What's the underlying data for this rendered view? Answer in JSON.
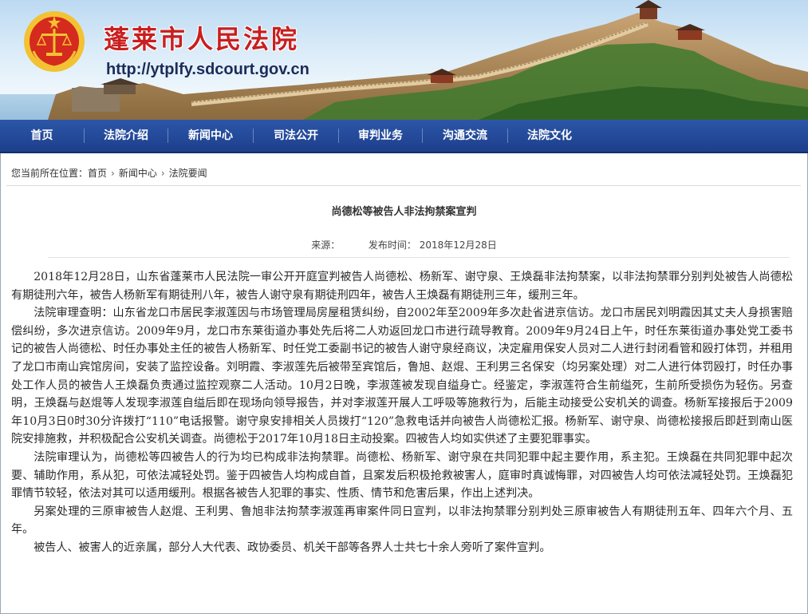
{
  "site": {
    "title": "蓬莱市人民法院",
    "url": "http://ytplfy.sdcourt.gov.cn"
  },
  "nav": {
    "items": [
      "首页",
      "法院介绍",
      "新闻中心",
      "司法公开",
      "审判业务",
      "沟通交流",
      "法院文化"
    ]
  },
  "breadcrumb": {
    "prefix": "您当前所在位置：",
    "items": [
      "首页",
      "新闻中心",
      "法院要闻"
    ],
    "separator": "›"
  },
  "article": {
    "title": "尚德松等被告人非法拘禁案宣判",
    "source_label": "来源：",
    "date_label": "发布时间：",
    "date": "2018年12月28日",
    "paragraphs": [
      "2018年12月28日，山东省蓬莱市人民法院一审公开开庭宣判被告人尚德松、杨新军、谢守泉、王焕磊非法拘禁案，以非法拘禁罪分别判处被告人尚德松有期徒刑六年，被告人杨新军有期徒刑八年，被告人谢守泉有期徒刑四年，被告人王焕磊有期徒刑三年，缓刑三年。",
      "法院审理查明：山东省龙口市居民李淑莲因与市场管理局房屋租赁纠纷，自2002年至2009年多次赴省进京信访。龙口市居民刘明霞因其丈夫人身损害赔偿纠纷，多次进京信访。2009年9月，龙口市东莱街道办事处先后将二人劝返回龙口市进行疏导教育。2009年9月24日上午，时任东莱街道办事处党工委书记的被告人尚德松、时任办事处主任的被告人杨新军、时任党工委副书记的被告人谢守泉经商议，决定雇用保安人员对二人进行封闭看管和殴打体罚，并租用了龙口市南山宾馆房间，安装了监控设备。刘明霞、李淑莲先后被带至宾馆后，鲁旭、赵焜、王利男三名保安（均另案处理）对二人进行体罚殴打，时任办事处工作人员的被告人王焕磊负责通过监控观察二人活动。10月2日晚，李淑莲被发现自缢身亡。经鉴定，李淑莲符合生前缢死，生前所受损伤为轻伤。另查明，王焕磊与赵焜等人发现李淑莲自缢后即在现场向领导报告，并对李淑莲开展人工呼吸等施救行为，后能主动接受公安机关的调查。杨新军接报后于2009年10月3日0时30分许拨打“110”电话报警。谢守泉安排相关人员拨打“120”急救电话并向被告人尚德松汇报。杨新军、谢守泉、尚德松接报后即赶到南山医院安排施救，并积极配合公安机关调查。尚德松于2017年10月18日主动投案。四被告人均如实供述了主要犯罪事实。",
      "法院审理认为，尚德松等四被告人的行为均已构成非法拘禁罪。尚德松、杨新军、谢守泉在共同犯罪中起主要作用，系主犯。王焕磊在共同犯罪中起次要、辅助作用，系从犯，可依法减轻处罚。鉴于四被告人均构成自首，且案发后积极抢救被害人，庭审时真诚悔罪，对四被告人均可依法减轻处罚。王焕磊犯罪情节较轻，依法对其可以适用缓刑。根据各被告人犯罪的事实、性质、情节和危害后果，作出上述判决。",
      "另案处理的三原审被告人赵焜、王利男、鲁旭非法拘禁李淑莲再审案件同日宣判，以非法拘禁罪分别判处三原审被告人有期徒刑五年、四年六个月、五年。",
      "被告人、被害人的近亲属，部分人大代表、政协委员、机关干部等各界人士共七十余人旁听了案件宣判。"
    ]
  },
  "colors": {
    "nav_bg": "#1d3f8c",
    "title_red": "#c81f1f"
  },
  "icons": {
    "emblem": "court-emblem-icon"
  }
}
